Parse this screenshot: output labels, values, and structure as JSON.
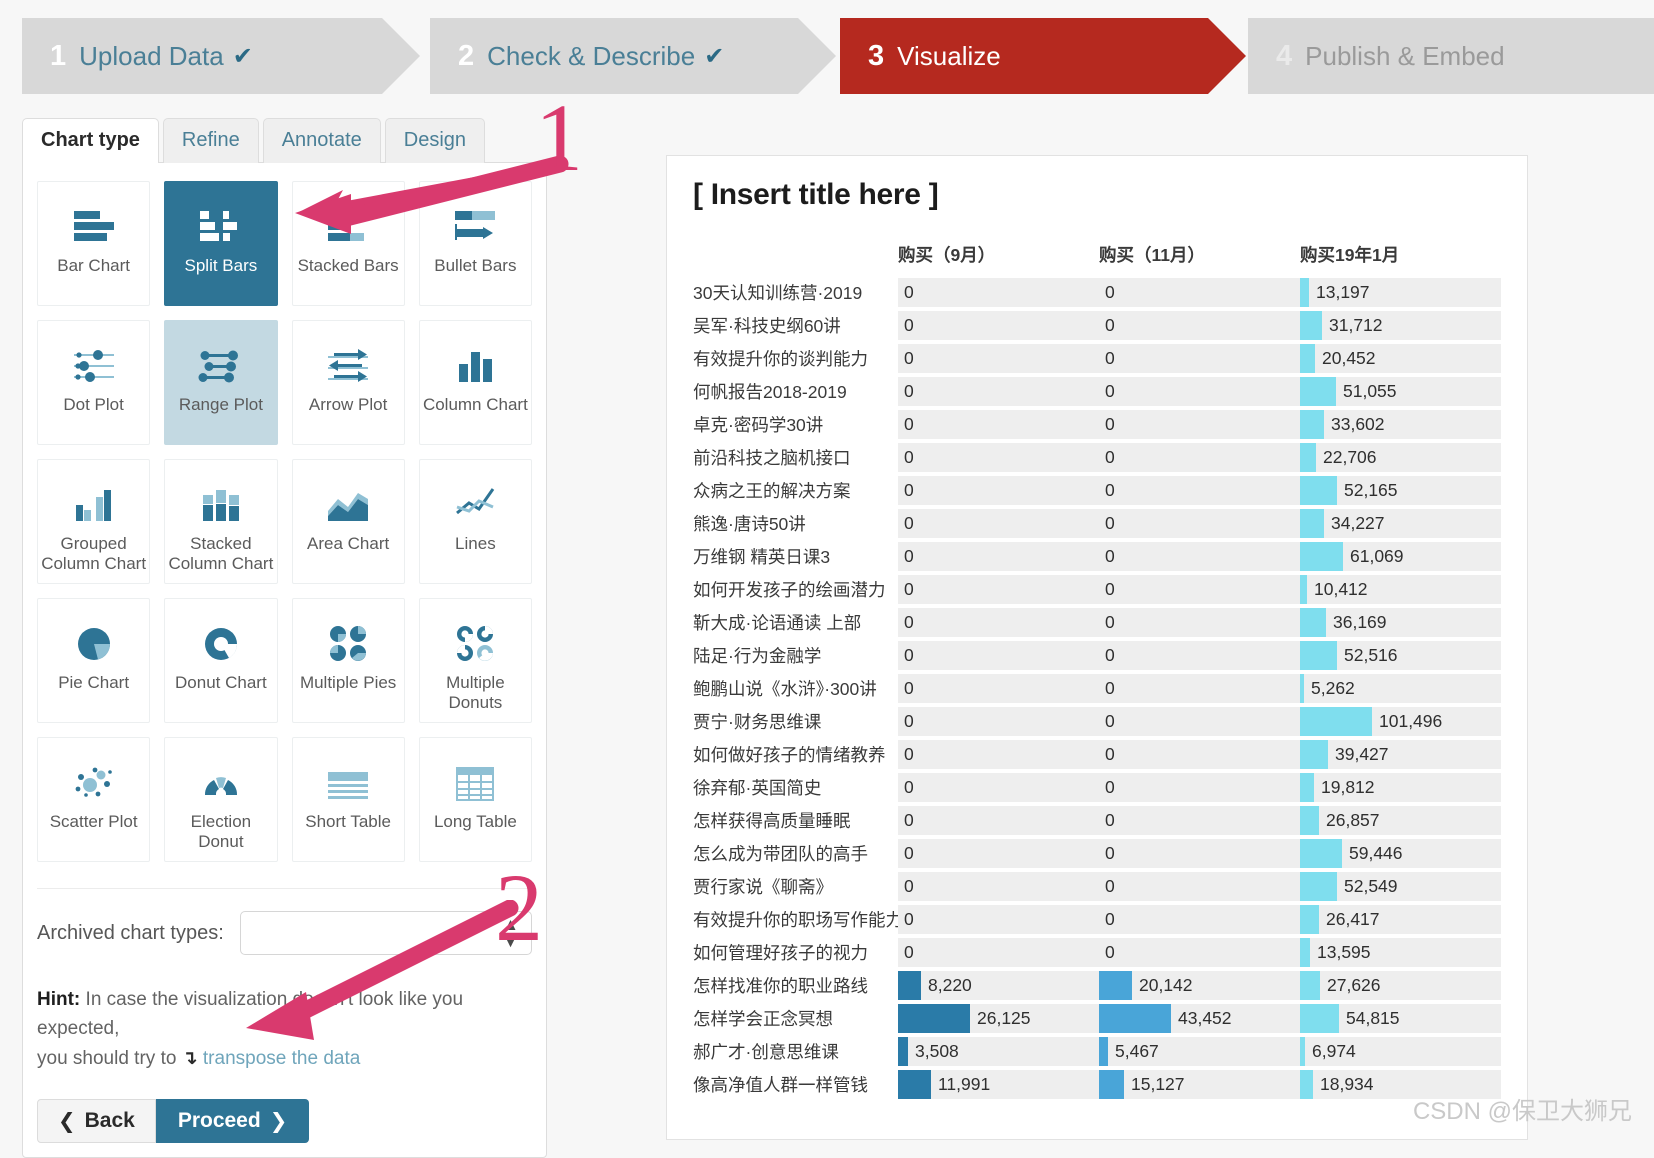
{
  "wizard": {
    "steps": [
      {
        "num": "1",
        "label": "Upload Data",
        "tick": "✔",
        "state": "done"
      },
      {
        "num": "2",
        "label": "Check & Describe",
        "tick": "✔",
        "state": "done"
      },
      {
        "num": "3",
        "label": "Visualize",
        "tick": "",
        "state": "active"
      },
      {
        "num": "4",
        "label": "Publish & Embed",
        "tick": "",
        "state": "muted"
      }
    ],
    "active_color": "#b5291f",
    "inactive_color": "#d8d8d8"
  },
  "tabs": [
    {
      "label": "Chart type",
      "active": true
    },
    {
      "label": "Refine",
      "active": false
    },
    {
      "label": "Annotate",
      "active": false
    },
    {
      "label": "Design",
      "active": false
    }
  ],
  "chart_types": [
    {
      "label": "Bar Chart",
      "icon": "bar-chart-icon",
      "state": "normal"
    },
    {
      "label": "Split Bars",
      "icon": "split-bars-icon",
      "state": "selected"
    },
    {
      "label": "Stacked Bars",
      "icon": "stacked-bars-icon",
      "state": "normal"
    },
    {
      "label": "Bullet Bars",
      "icon": "bullet-bars-icon",
      "state": "normal"
    },
    {
      "label": "Dot Plot",
      "icon": "dot-plot-icon",
      "state": "normal"
    },
    {
      "label": "Range Plot",
      "icon": "range-plot-icon",
      "state": "hover"
    },
    {
      "label": "Arrow Plot",
      "icon": "arrow-plot-icon",
      "state": "normal"
    },
    {
      "label": "Column Chart",
      "icon": "column-chart-icon",
      "state": "normal"
    },
    {
      "label": "Grouped Column Chart",
      "icon": "grouped-column-chart-icon",
      "state": "normal"
    },
    {
      "label": "Stacked Column Chart",
      "icon": "stacked-column-chart-icon",
      "state": "normal"
    },
    {
      "label": "Area Chart",
      "icon": "area-chart-icon",
      "state": "normal"
    },
    {
      "label": "Lines",
      "icon": "lines-icon",
      "state": "normal"
    },
    {
      "label": "Pie Chart",
      "icon": "pie-chart-icon",
      "state": "normal"
    },
    {
      "label": "Donut Chart",
      "icon": "donut-chart-icon",
      "state": "normal"
    },
    {
      "label": "Multiple Pies",
      "icon": "multiple-pies-icon",
      "state": "normal"
    },
    {
      "label": "Multiple Donuts",
      "icon": "multiple-donuts-icon",
      "state": "normal"
    },
    {
      "label": "Scatter Plot",
      "icon": "scatter-plot-icon",
      "state": "normal"
    },
    {
      "label": "Election Donut",
      "icon": "election-donut-icon",
      "state": "normal"
    },
    {
      "label": "Short Table",
      "icon": "short-table-icon",
      "state": "normal"
    },
    {
      "label": "Long Table",
      "icon": "long-table-icon",
      "state": "normal"
    }
  ],
  "archived": {
    "label": "Archived chart types:",
    "value": "",
    "placeholder": ""
  },
  "hint": {
    "prefix": "Hint:",
    "line1": " In case the visualization doesn't look like you expected,",
    "line2_pre": "you should try to ",
    "icon": "transpose-icon",
    "link": "transpose the data"
  },
  "buttons": {
    "back": "Back",
    "back_icon": "chevron-left-icon",
    "proceed": "Proceed",
    "proceed_icon": "chevron-right-icon",
    "proceed_color": "#2e7495"
  },
  "annotations": [
    {
      "label": "1",
      "color": "#d93a6e",
      "points_to": "Split Bars tile"
    },
    {
      "label": "2",
      "color": "#d93a6e",
      "points_to": "Proceed button"
    }
  ],
  "watermark": "CSDN @保卫大狮兄",
  "chart_data": {
    "type": "bar",
    "title": "[ Insert title here ]",
    "layout": "split bars (small multiples table)",
    "row_header": "",
    "categories": [
      "30天认知训练营·2019",
      "吴军·科技史纲60讲",
      "有效提升你的谈判能力",
      "何帆报告2018-2019",
      "卓克·密码学30讲",
      "前沿科技之脑机接口",
      "众病之王的解决方案",
      "熊逸·唐诗50讲",
      "万维钢 精英日课3",
      "如何开发孩子的绘画潜力",
      "靳大成·论语通读 上部",
      "陆足·行为金融学",
      "鲍鹏山说《水浒》·300讲",
      "贾宁·财务思维课",
      "如何做好孩子的情绪教养",
      "徐弃郁·英国简史",
      "怎样获得高质量睡眠",
      "怎么成为带团队的高手",
      "贾行家说《聊斋》",
      "有效提升你的职场写作能力",
      "如何管理好孩子的视力",
      "怎样找准你的职业路线",
      "怎样学会正念冥想",
      "郝广才·创意思维课",
      "像高净值人群一样管钱"
    ],
    "series": [
      {
        "name": "购买（9月）",
        "color": "#2a7ba8",
        "max": 26125,
        "values": [
          0,
          0,
          0,
          0,
          0,
          0,
          0,
          0,
          0,
          0,
          0,
          0,
          0,
          0,
          0,
          0,
          0,
          0,
          0,
          0,
          0,
          8220,
          26125,
          3508,
          11991
        ],
        "labels": [
          "0",
          "0",
          "0",
          "0",
          "0",
          "0",
          "0",
          "0",
          "0",
          "0",
          "0",
          "0",
          "0",
          "0",
          "0",
          "0",
          "0",
          "0",
          "0",
          "0",
          "0",
          "8,220",
          "26,125",
          "3,508",
          "11,991"
        ]
      },
      {
        "name": "购买（11月）",
        "color": "#49a5d8",
        "max": 43452,
        "values": [
          0,
          0,
          0,
          0,
          0,
          0,
          0,
          0,
          0,
          0,
          0,
          0,
          0,
          0,
          0,
          0,
          0,
          0,
          0,
          0,
          0,
          20142,
          43452,
          5467,
          15127
        ],
        "labels": [
          "0",
          "0",
          "0",
          "0",
          "0",
          "0",
          "0",
          "0",
          "0",
          "0",
          "0",
          "0",
          "0",
          "0",
          "0",
          "0",
          "0",
          "0",
          "0",
          "0",
          "0",
          "20,142",
          "43,452",
          "5,467",
          "15,127"
        ]
      },
      {
        "name": "购买19年1月",
        "color": "#7fdeee",
        "max": 101496,
        "values": [
          13197,
          31712,
          20452,
          51055,
          33602,
          22706,
          52165,
          34227,
          61069,
          10412,
          36169,
          52516,
          5262,
          101496,
          39427,
          19812,
          26857,
          59446,
          52549,
          26417,
          13595,
          27626,
          54815,
          6974,
          18934
        ],
        "labels": [
          "13,197",
          "31,712",
          "20,452",
          "51,055",
          "33,602",
          "22,706",
          "52,165",
          "34,227",
          "61,069",
          "10,412",
          "36,169",
          "52,516",
          "5,262",
          "101,496",
          "39,427",
          "19,812",
          "26,857",
          "59,446",
          "52,549",
          "26,417",
          "13,595",
          "27,626",
          "54,815",
          "6,974",
          "18,934"
        ]
      }
    ]
  }
}
